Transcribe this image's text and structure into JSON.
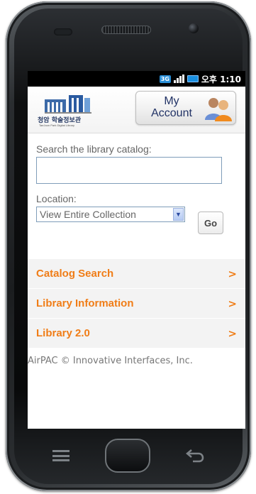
{
  "statusbar": {
    "network": "3G",
    "time": "오후 1:10"
  },
  "header": {
    "logo_korean": "청암 학술정보관",
    "logo_english": "TaeJoon Park Digital Library",
    "account_line1": "My",
    "account_line2": "Account"
  },
  "search": {
    "label": "Search the library catalog:",
    "value": "",
    "placeholder": "",
    "location_label": "Location:",
    "location_selected": "View Entire Collection",
    "go_label": "Go"
  },
  "menu": {
    "items": [
      {
        "label": "Catalog Search",
        "chevron": ">"
      },
      {
        "label": "Library Information",
        "chevron": ">"
      },
      {
        "label": "Library 2.0",
        "chevron": ">"
      }
    ]
  },
  "footer": {
    "text": "AirPAC © Innovative Interfaces, Inc."
  },
  "colors": {
    "accent": "#f07d17",
    "menu_background": "#f3f3f3",
    "brand_blue": "#2a3d66"
  },
  "icons": {
    "logo": "library-building-logo",
    "account": "users-icon",
    "menu": "menu-icon",
    "back": "back-arrow-icon"
  }
}
